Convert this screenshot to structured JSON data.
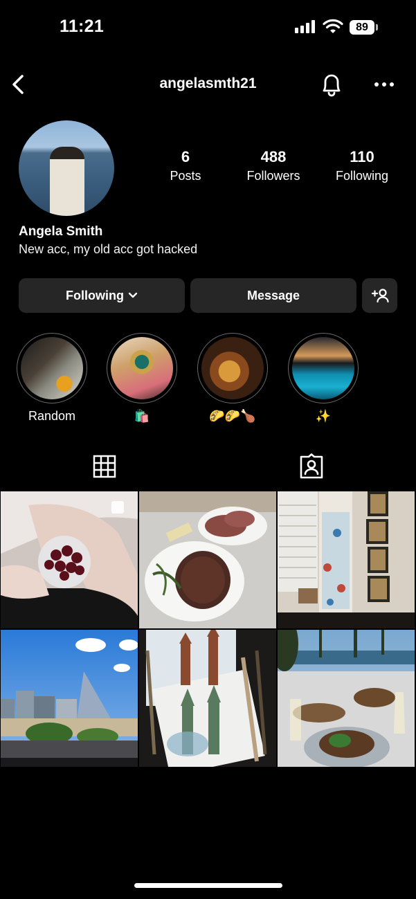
{
  "status_bar": {
    "time": "11:21",
    "battery": "89",
    "icons": [
      "signal-icon",
      "wifi-icon",
      "battery-icon"
    ]
  },
  "header": {
    "username": "angelasmth21",
    "icons": [
      "back-chevron-icon",
      "bell-icon",
      "more-icon"
    ]
  },
  "profile": {
    "full_name": "Angela Smith",
    "bio": "New acc, my old acc got hacked",
    "stats": [
      {
        "value": "6",
        "label": "Posts"
      },
      {
        "value": "488",
        "label": "Followers"
      },
      {
        "value": "110",
        "label": "Following"
      }
    ]
  },
  "actions": {
    "following_label": "Following",
    "message_label": "Message",
    "icons": [
      "chevron-down-icon",
      "add-person-icon"
    ]
  },
  "highlights": [
    {
      "label": "Random"
    },
    {
      "label": "🛍️"
    },
    {
      "label": "🌮🌮🍗"
    },
    {
      "label": "✨"
    }
  ],
  "tabs": [
    "grid-icon",
    "tagged-icon"
  ],
  "colors": {
    "background": "#000000",
    "button": "#262626",
    "text": "#ffffff"
  }
}
